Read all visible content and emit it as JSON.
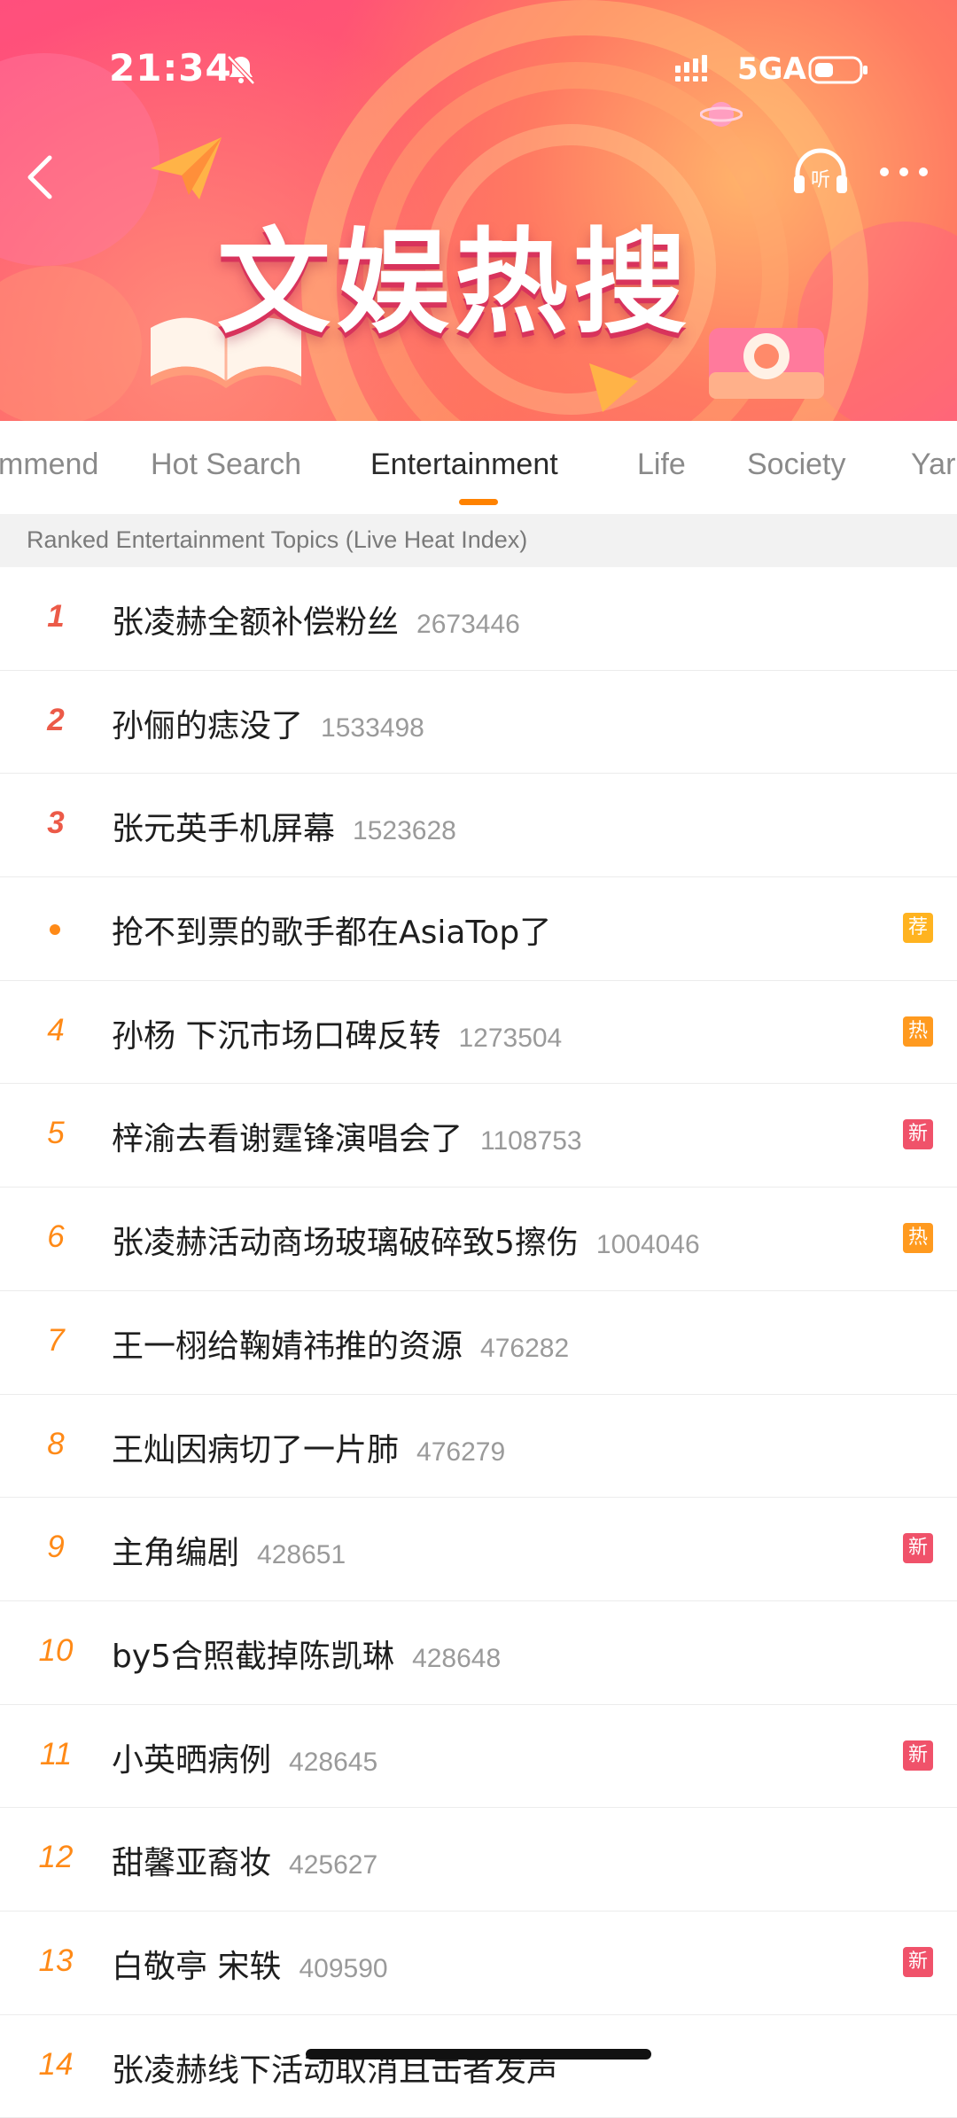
{
  "status_bar": {
    "time": "21:34",
    "network": "5GA"
  },
  "header": {
    "banner_title": "文娱热搜"
  },
  "tabs": [
    {
      "label": "mmend",
      "active": false
    },
    {
      "label": "Hot Search",
      "active": false
    },
    {
      "label": "Entertainment",
      "active": true
    },
    {
      "label": "Life",
      "active": false
    },
    {
      "label": "Society",
      "active": false
    },
    {
      "label": "Yar",
      "active": false
    }
  ],
  "section_header": "Ranked Entertainment Topics (Live Heat Index)",
  "colors": {
    "accent": "#ff8200",
    "rank_top": "#ec5a48",
    "rank": "#ff8a17",
    "badge_new": "#f0526a",
    "badge_hot": "#ff9a1f",
    "badge_rec": "#ffb320"
  },
  "items": [
    {
      "rank": "1",
      "title": "张凌赫全额补偿粉丝",
      "heat": "2673446",
      "badge": ""
    },
    {
      "rank": "2",
      "title": "孙俪的痣没了",
      "heat": "1533498",
      "badge": ""
    },
    {
      "rank": "3",
      "title": "张元英手机屏幕",
      "heat": "1523628",
      "badge": ""
    },
    {
      "rank": "",
      "title": "抢不到票的歌手都在AsiaTop了",
      "heat": "",
      "badge": "荐"
    },
    {
      "rank": "4",
      "title": "孙杨 下沉市场口碑反转",
      "heat": "1273504",
      "badge": "热"
    },
    {
      "rank": "5",
      "title": "梓渝去看谢霆锋演唱会了",
      "heat": "1108753",
      "badge": "新"
    },
    {
      "rank": "6",
      "title": "张凌赫活动商场玻璃破碎致5擦伤",
      "heat": "1004046",
      "badge": "热"
    },
    {
      "rank": "7",
      "title": "王一栩给鞠婧祎推的资源",
      "heat": "476282",
      "badge": ""
    },
    {
      "rank": "8",
      "title": "王灿因病切了一片肺",
      "heat": "476279",
      "badge": ""
    },
    {
      "rank": "9",
      "title": "主角编剧",
      "heat": "428651",
      "badge": "新"
    },
    {
      "rank": "10",
      "title": "by5合照截掉陈凯琳",
      "heat": "428648",
      "badge": ""
    },
    {
      "rank": "11",
      "title": "小英晒病例",
      "heat": "428645",
      "badge": "新"
    },
    {
      "rank": "12",
      "title": "甜馨亚裔妆",
      "heat": "425627",
      "badge": ""
    },
    {
      "rank": "13",
      "title": "白敬亭 宋轶",
      "heat": "409590",
      "badge": "新"
    },
    {
      "rank": "14",
      "title": "张凌赫线下活动取消且击者发声",
      "heat": "",
      "badge": ""
    }
  ]
}
